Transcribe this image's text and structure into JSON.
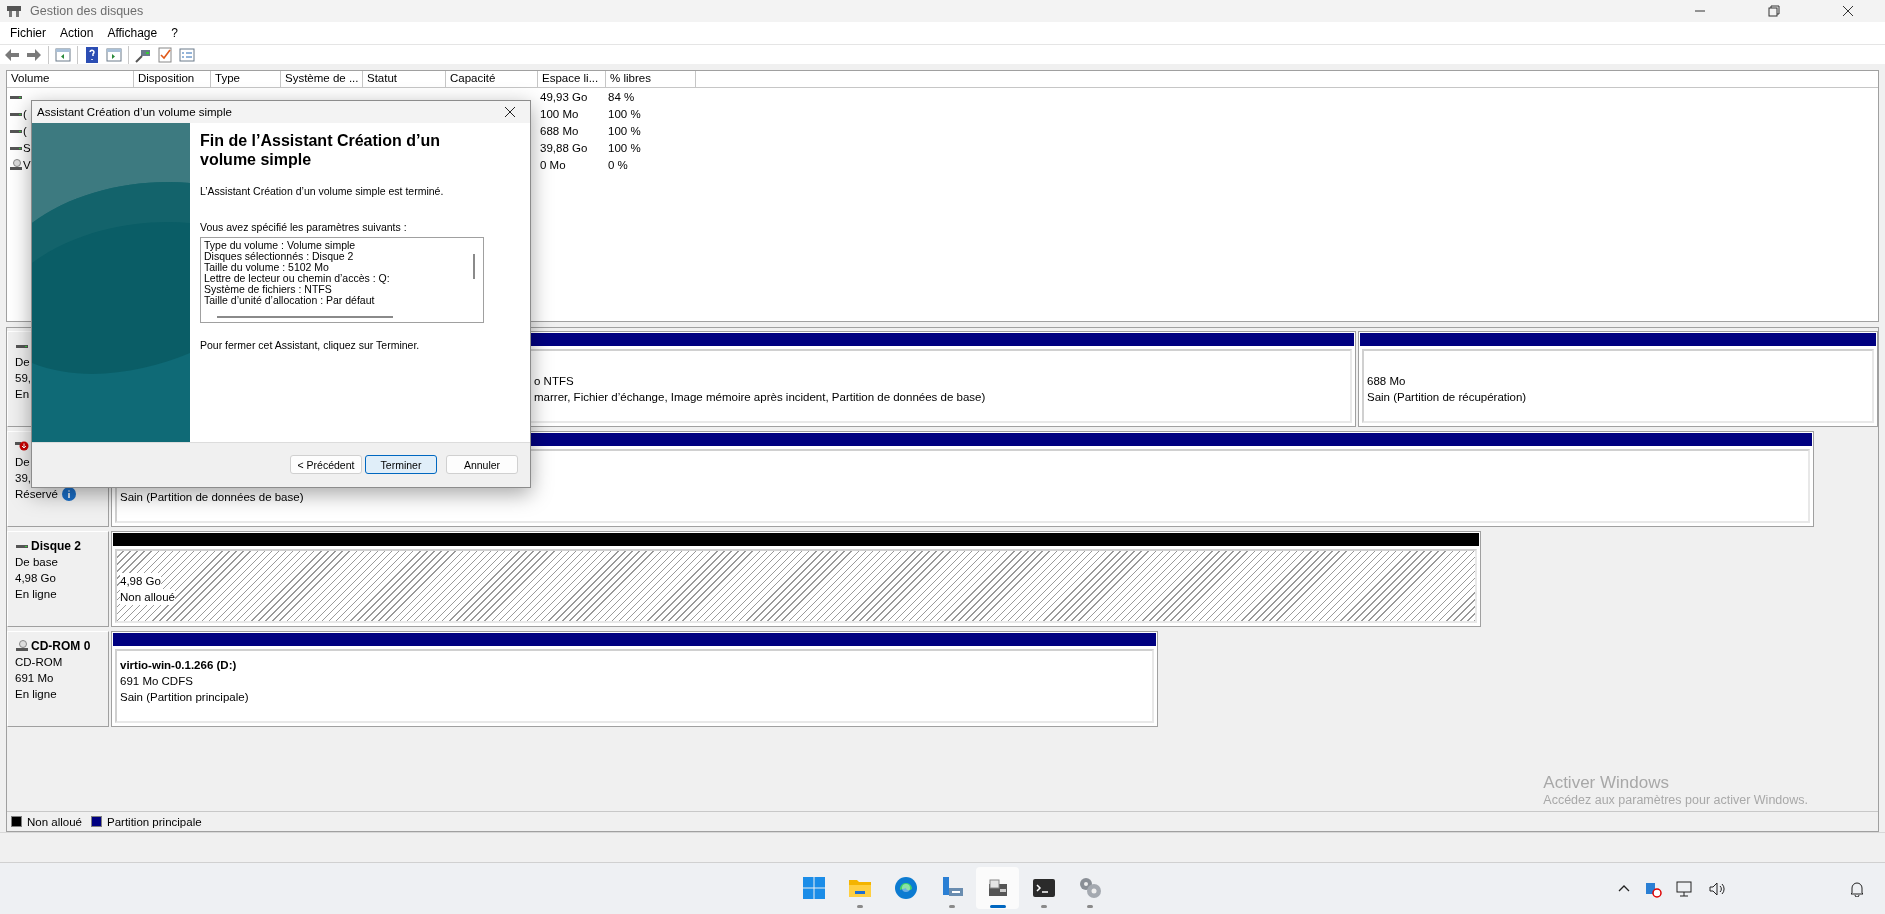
{
  "window": {
    "title": "Gestion des disques"
  },
  "menu": [
    "Fichier",
    "Action",
    "Affichage",
    "?"
  ],
  "volume_table": {
    "columns": [
      "Volume",
      "Disposition",
      "Type",
      "Système de ...",
      "Statut",
      "Capacité",
      "Espace li...",
      "% libres"
    ],
    "rows": [
      {
        "kind": "drive",
        "free": "49,93 Go",
        "percent_free": "84 %"
      },
      {
        "kind": "drive",
        "volume": "(",
        "free": "100 Mo",
        "percent_free": "100 %"
      },
      {
        "kind": "drive",
        "volume": "(",
        "free": "688 Mo",
        "percent_free": "100 %"
      },
      {
        "kind": "drive",
        "volume": "S",
        "free": "39,88 Go",
        "percent_free": "100 %"
      },
      {
        "kind": "cdrom",
        "volume": "V",
        "free": "0 Mo",
        "percent_free": "0 %"
      }
    ]
  },
  "disks": [
    {
      "kind": "drive",
      "lines": [
        "De",
        "59,",
        "En"
      ],
      "partitions": [
        {
          "kind": "primary",
          "lines": [
            "o NTFS",
            "marrer, Fichier d’échange, Image mémoire après incident, Partition de données de base)"
          ]
        },
        {
          "kind": "primary",
          "lines": [
            "688 Mo",
            "Sain (Partition de récupération)"
          ]
        }
      ]
    },
    {
      "kind": "alert",
      "lines": [
        "De",
        "39,"
      ],
      "note": "Réservé",
      "partitions": [
        {
          "kind": "primary",
          "lines": [
            "Sain (Partition de données de base)"
          ]
        }
      ]
    },
    {
      "kind": "drive",
      "name": "Disque 2",
      "lines": [
        "De base",
        "4,98 Go",
        "En ligne"
      ],
      "partitions": [
        {
          "kind": "unallocated",
          "lines": [
            "4,98 Go",
            "Non alloué"
          ]
        }
      ]
    },
    {
      "kind": "cdrom",
      "name": "CD-ROM 0",
      "lines": [
        "CD-ROM",
        "691 Mo",
        "En ligne"
      ],
      "partitions": [
        {
          "kind": "primary",
          "title": "virtio-win-0.1.266  (D:)",
          "lines": [
            "691 Mo CDFS",
            "Sain (Partition principale)"
          ]
        }
      ]
    }
  ],
  "legend": [
    {
      "label": "Non alloué",
      "color": "#000000"
    },
    {
      "label": "Partition principale",
      "color": "#000080"
    }
  ],
  "activation_notice": {
    "title": "Activer Windows",
    "text": "Accédez aux paramètres pour activer Windows."
  },
  "dialog": {
    "title": "Assistant Création d’un volume simple",
    "heading": "Fin de l’Assistant Création d’un volume simple",
    "intro": "L’Assistant Création d’un volume simple est terminé.",
    "summary_label": "Vous avez spécifié les paramètres suivants :",
    "summary": [
      "Type du volume : Volume simple",
      "Disques sélectionnés : Disque 2",
      "Taille du volume : 5102 Mo",
      "Lettre de lecteur ou chemin d’accès : Q:",
      "Système de fichiers : NTFS",
      "Taille d’unité d’allocation : Par défaut"
    ],
    "closing": "Pour fermer cet Assistant, cliquez sur Terminer.",
    "buttons": [
      {
        "label": "< Précédent",
        "selected": false
      },
      {
        "label": "Terminer",
        "selected": true
      },
      {
        "label": "Annuler",
        "selected": false
      }
    ]
  },
  "taskbar": [
    {
      "kind": "start",
      "open": false,
      "selected": false
    },
    {
      "kind": "folder",
      "open": true,
      "selected": false
    },
    {
      "kind": "browser",
      "open": false,
      "selected": false
    },
    {
      "kind": "server",
      "open": true,
      "selected": false
    },
    {
      "kind": "disk",
      "open": true,
      "selected": true
    },
    {
      "kind": "terminal",
      "open": true,
      "selected": false
    },
    {
      "kind": "gears",
      "open": true,
      "selected": false
    }
  ]
}
